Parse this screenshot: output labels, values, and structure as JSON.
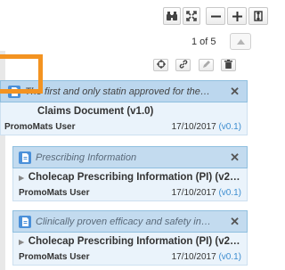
{
  "pager": {
    "text": "1 of 5"
  },
  "cards": [
    {
      "title": "The first and only statin approved for the…",
      "document": "Claims Document (v1.0)",
      "user": "PromoMats User",
      "date": "17/10/2017",
      "version": "(v0.1)"
    },
    {
      "title": "Prescribing Information",
      "document": "Cholecap Prescribing Information (PI) (v2…",
      "user": "PromoMats User",
      "date": "17/10/2017",
      "version": "(v0.1)"
    },
    {
      "title": "Clinically proven efficacy and safety in…",
      "document": "Cholecap Prescribing Information (PI) (v2…",
      "user": "PromoMats User",
      "date": "17/10/2017",
      "version": "(v0.1)"
    }
  ],
  "close_symbol": "✕",
  "expand_symbol": "▸",
  "icons": {
    "toolbar": [
      "binoculars-icon",
      "fit-screen-icon",
      "zoom-out-icon",
      "zoom-in-icon",
      "fit-height-icon",
      "fit-width-icon",
      "search-icon"
    ],
    "nav": [
      "arrow-up-icon",
      "arrow-down-icon"
    ],
    "actions": [
      "target-icon",
      "link-icon",
      "edit-icon",
      "trash-icon"
    ],
    "card": [
      "document-badge-icon"
    ]
  },
  "colors": {
    "highlight": "#f39321",
    "card_header": "#bcd7ee",
    "card_body": "#eaf3fb",
    "version_link": "#3c8dd0",
    "badge": "#4a90d9"
  }
}
